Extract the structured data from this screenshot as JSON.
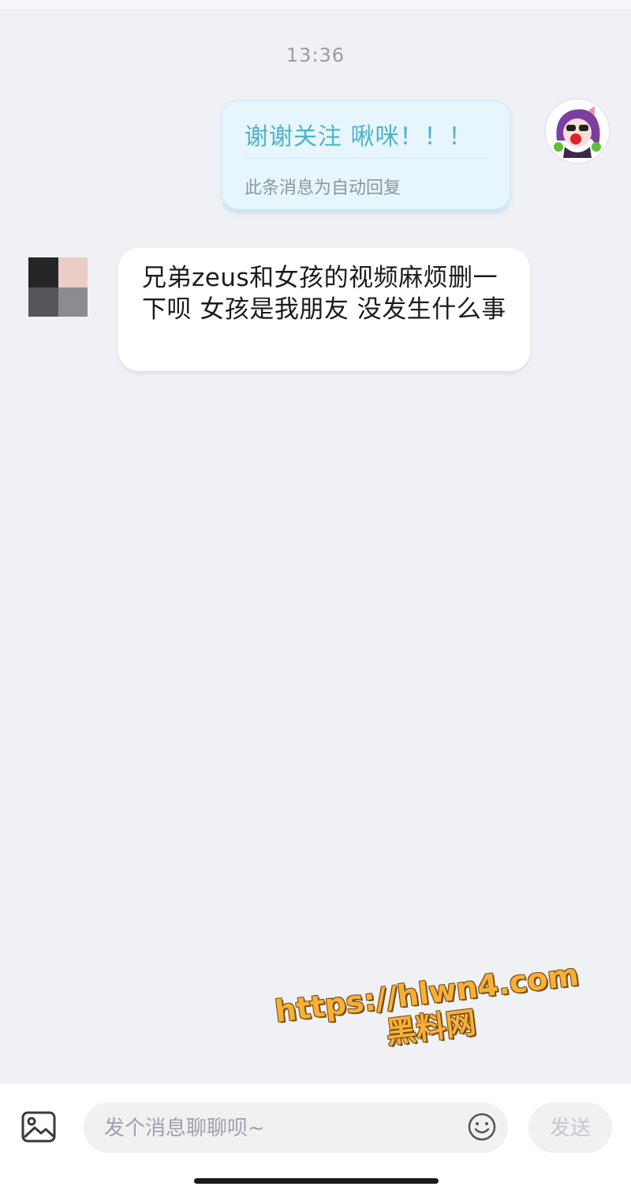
{
  "chat": {
    "timestamp": "13:36",
    "outgoing": {
      "text": "谢谢关注  啾咪！！！",
      "auto_reply_note": "此条消息为自动回复"
    },
    "incoming": {
      "text": "兄弟zeus和女孩的视频麻烦删一下呗 女孩是我朋友 没发生什么事"
    }
  },
  "watermark": {
    "url": "https://hlwn4.com",
    "label": "黑料网"
  },
  "composer": {
    "placeholder": "发个消息聊聊呗~",
    "value": "",
    "send_label": "发送",
    "image_icon": "image-icon",
    "emoji_icon": "emoji-icon"
  },
  "colors": {
    "background": "#f0f1f4",
    "outgoing_bubble": "#e7f6fd",
    "outgoing_text": "#4fb3c9",
    "incoming_bubble": "#ffffff",
    "watermark": "#f7b137"
  }
}
